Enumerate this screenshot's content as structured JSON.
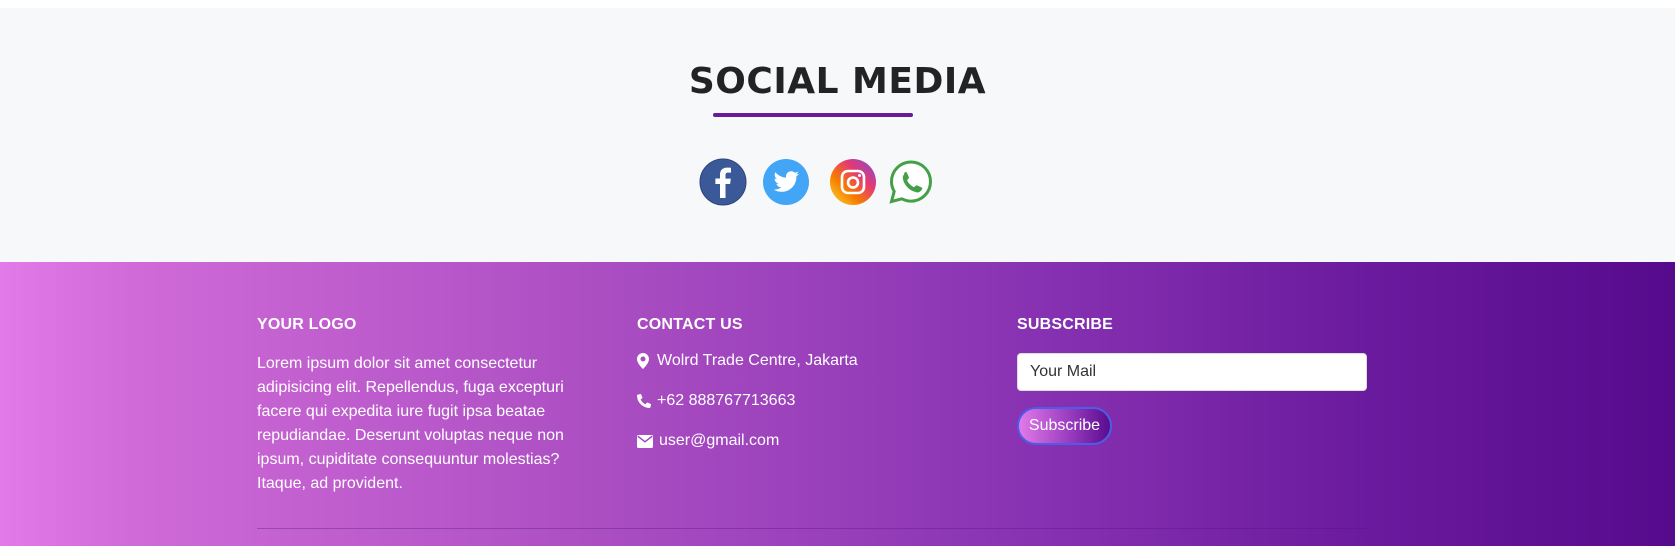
{
  "social": {
    "title": "SOCIAL MEDIA",
    "accent_color": "#6a1b9a",
    "icons": [
      "facebook-icon",
      "twitter-icon",
      "instagram-icon",
      "whatsapp-icon"
    ]
  },
  "footer": {
    "about": {
      "heading": "YOUR LOGO",
      "text": "Lorem ipsum dolor sit amet consectetur adipisicing elit. Repellendus, fuga excepturi facere qui expedita iure fugit ipsa beatae repudiandae. Deserunt voluptas neque non ipsum, cupiditate consequuntur molestias? Itaque, ad provident."
    },
    "contact": {
      "heading": "CONTACT US",
      "address": "Wolrd Trade Centre, Jakarta",
      "phone": "+62 888767713663",
      "email": "user@gmail.com",
      "icons": [
        "map-marker-icon",
        "phone-icon",
        "envelope-icon"
      ]
    },
    "subscribe": {
      "heading": "SUBSCRIBE",
      "input_placeholder": "Your Mail",
      "button_label": "Subscribe"
    },
    "gradient": [
      "#e27ae9",
      "#560a8c"
    ]
  }
}
